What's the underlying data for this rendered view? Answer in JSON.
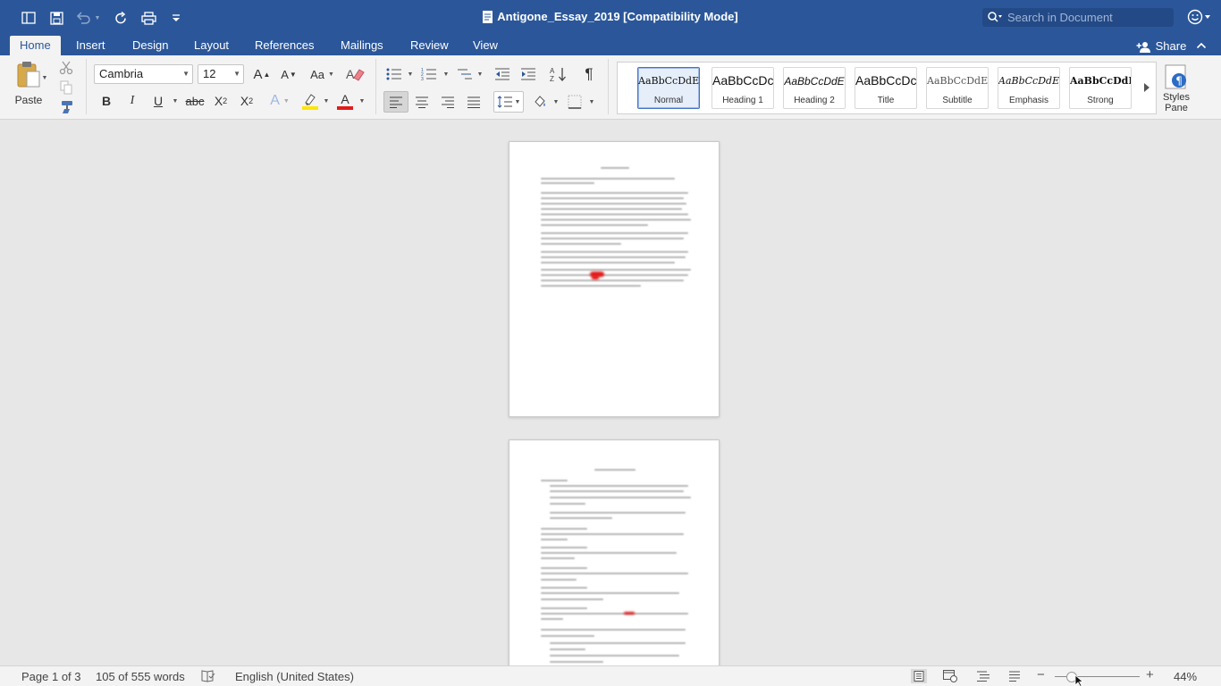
{
  "window": {
    "title": "Antigone_Essay_2019 [Compatibility Mode]",
    "search_placeholder": "Search in Document"
  },
  "quick_access": [
    "sidebar-icon",
    "save-icon",
    "undo-icon",
    "redo-icon",
    "print-icon",
    "customize-icon"
  ],
  "tabs": [
    {
      "label": "Home",
      "active": true
    },
    {
      "label": "Insert"
    },
    {
      "label": "Design"
    },
    {
      "label": "Layout"
    },
    {
      "label": "References"
    },
    {
      "label": "Mailings"
    },
    {
      "label": "Review"
    },
    {
      "label": "View"
    }
  ],
  "share_label": "Share",
  "ribbon": {
    "paste_label": "Paste",
    "font_name": "Cambria",
    "font_size": "12",
    "bold": "B",
    "italic": "I",
    "underline": "U",
    "strikethrough": "abc",
    "subscript": "X",
    "subscript_sub": "2",
    "superscript": "X",
    "superscript_sup": "2",
    "grow_font": "A",
    "shrink_font": "A",
    "change_case": "Aa",
    "text_effects": "A",
    "font_color_letter": "A",
    "pilcrow": "¶",
    "font_color": "#e31b1b",
    "highlight_color": "#ffe600"
  },
  "styles": [
    {
      "sample": "AaBbCcDdEe",
      "name": "Normal",
      "selected": true
    },
    {
      "sample": "AaBbCcDc",
      "name": "Heading 1"
    },
    {
      "sample": "AaBbCcDdE",
      "name": "Heading 2"
    },
    {
      "sample": "AaBbCcDc",
      "name": "Title"
    },
    {
      "sample": "AaBbCcDdEe",
      "name": "Subtitle"
    },
    {
      "sample": "AaBbCcDdEe",
      "name": "Emphasis"
    },
    {
      "sample": "AaBbCcDdE",
      "name": "Strong"
    }
  ],
  "styles_pane_label": "Styles Pane",
  "status": {
    "page": "Page 1 of 3",
    "words": "105 of 555 words",
    "language": "English (United States)",
    "zoom": "44%",
    "zoom_value": 0.44
  },
  "colors": {
    "brand": "#2b579a",
    "ribbon_bg": "#f3f3f3"
  }
}
